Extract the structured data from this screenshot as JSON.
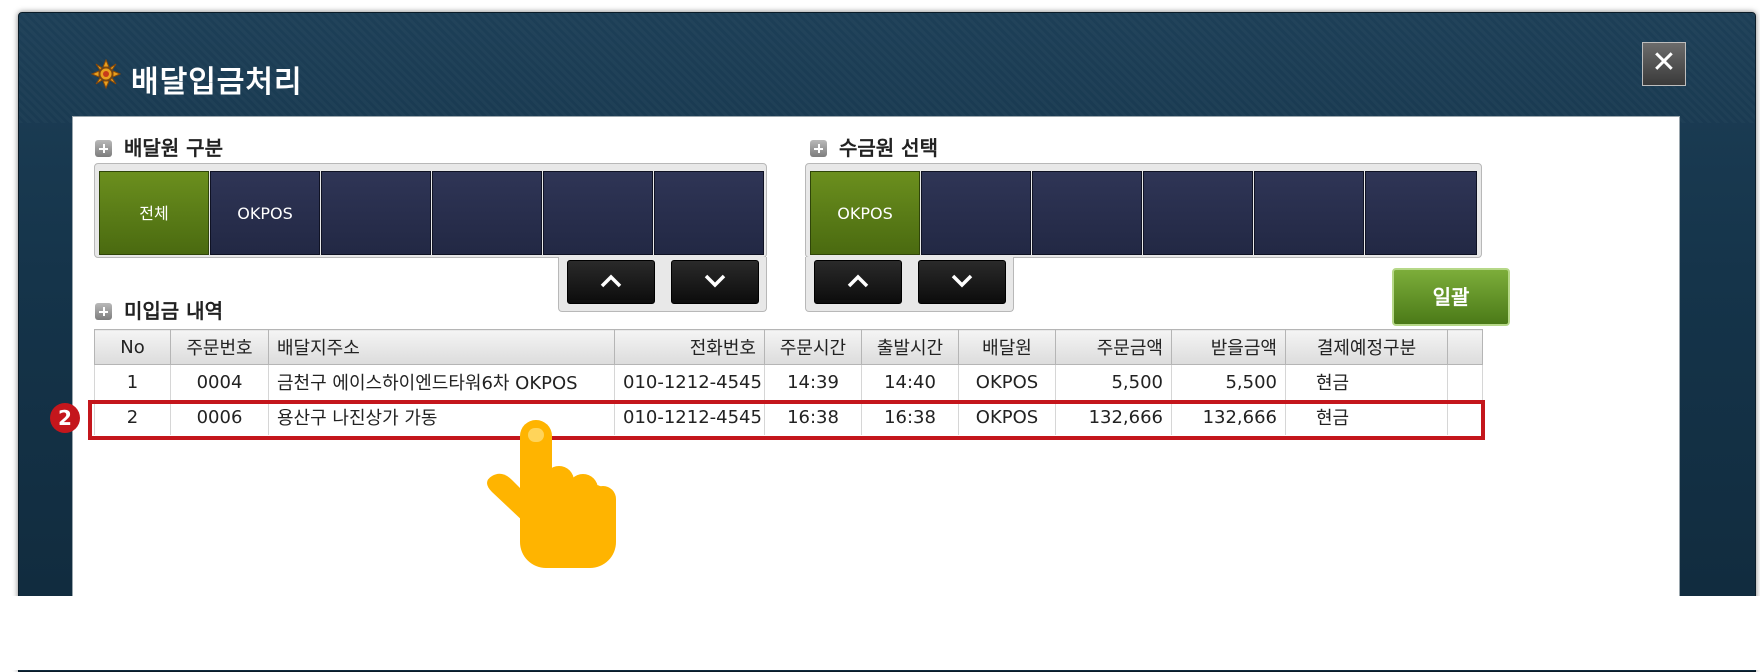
{
  "window": {
    "title": "배달입금처리",
    "close_label": "✕",
    "title_icon": "gear-flower-icon"
  },
  "delivery_section": {
    "label": "배달원 구분",
    "cells": [
      "전체",
      "OKPOS",
      "",
      "",
      "",
      ""
    ],
    "selected_index": 0
  },
  "collector_section": {
    "label": "수금원 선택",
    "cells": [
      "OKPOS",
      "",
      "",
      "",
      "",
      ""
    ],
    "selected_index": 0
  },
  "unpaid_section": {
    "label": "미입금 내역",
    "batch_button": "일괄"
  },
  "table": {
    "columns": [
      "No",
      "주문번호",
      "배달지주소",
      "전화번호",
      "주문시간",
      "출발시간",
      "배달원",
      "주문금액",
      "받을금액",
      "결제예정구분"
    ],
    "rows": [
      [
        "1",
        "0004",
        "금천구 에이스하이엔드타워6차 OKPOS",
        "010-1212-4545",
        "14:39",
        "14:40",
        "OKPOS",
        "5,500",
        "5,500",
        "현금"
      ],
      [
        "2",
        "0006",
        "용산구 나진상가 가동",
        "010-1212-4545",
        "16:38",
        "16:38",
        "OKPOS",
        "132,666",
        "132,666",
        "현금"
      ]
    ]
  },
  "annotation": {
    "step_number": "2"
  },
  "colors": {
    "selected_green": "#5a7d16",
    "cell_navy": "#2a2f4e",
    "highlight_red": "#c4161c",
    "window_blue": "#15344a"
  }
}
